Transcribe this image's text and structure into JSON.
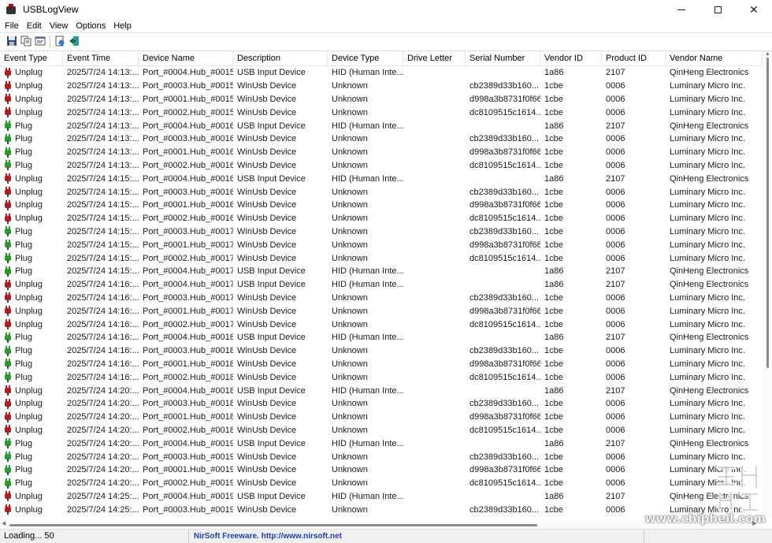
{
  "window": {
    "title": "USBLogView"
  },
  "menu": [
    "File",
    "Edit",
    "View",
    "Options",
    "Help"
  ],
  "toolbar": {
    "buttons": [
      {
        "name": "save-icon"
      },
      {
        "name": "copy-icon"
      },
      {
        "name": "properties-icon"
      },
      {
        "name": "html-report-icon"
      },
      {
        "name": "exit-icon"
      }
    ]
  },
  "columns": [
    "Event Type",
    "Event Time",
    "Device Name",
    "Description",
    "Device Type",
    "Drive Letter",
    "Serial Number",
    "Vendor ID",
    "Product ID",
    "Vendor Name"
  ],
  "rows": [
    [
      "Unplug",
      "2025/7/24 14:13:...",
      "Port_#0004.Hub_#0015",
      "USB Input Device",
      "HID (Human Inte...",
      "",
      "",
      "1a86",
      "2107",
      "QinHeng Electronics"
    ],
    [
      "Unplug",
      "2025/7/24 14:13:...",
      "Port_#0003.Hub_#0015",
      "WinUsb Device",
      "Unknown",
      "",
      "cb2389d33b160...",
      "1cbe",
      "0006",
      "Luminary Micro Inc."
    ],
    [
      "Unplug",
      "2025/7/24 14:13:...",
      "Port_#0001.Hub_#0015",
      "WinUsb Device",
      "Unknown",
      "",
      "d998a3b8731f0f66",
      "1cbe",
      "0006",
      "Luminary Micro Inc."
    ],
    [
      "Unplug",
      "2025/7/24 14:13:...",
      "Port_#0002.Hub_#0015",
      "WinUsb Device",
      "Unknown",
      "",
      "dc8109515c1614...",
      "1cbe",
      "0006",
      "Luminary Micro Inc."
    ],
    [
      "Plug",
      "2025/7/24 14:13:...",
      "Port_#0004.Hub_#0016",
      "USB Input Device",
      "HID (Human Inte...",
      "",
      "",
      "1a86",
      "2107",
      "QinHeng Electronics"
    ],
    [
      "Plug",
      "2025/7/24 14:13:...",
      "Port_#0003.Hub_#0016",
      "WinUsb Device",
      "Unknown",
      "",
      "cb2389d33b160...",
      "1cbe",
      "0006",
      "Luminary Micro Inc."
    ],
    [
      "Plug",
      "2025/7/24 14:13:...",
      "Port_#0001.Hub_#0016",
      "WinUsb Device",
      "Unknown",
      "",
      "d998a3b8731f0f66",
      "1cbe",
      "0006",
      "Luminary Micro Inc."
    ],
    [
      "Plug",
      "2025/7/24 14:13:...",
      "Port_#0002.Hub_#0016",
      "WinUsb Device",
      "Unknown",
      "",
      "dc8109515c1614...",
      "1cbe",
      "0006",
      "Luminary Micro Inc."
    ],
    [
      "Unplug",
      "2025/7/24 14:15:...",
      "Port_#0004.Hub_#0016",
      "USB Input Device",
      "HID (Human Inte...",
      "",
      "",
      "1a86",
      "2107",
      "QinHeng Electronics"
    ],
    [
      "Unplug",
      "2025/7/24 14:15:...",
      "Port_#0003.Hub_#0016",
      "WinUsb Device",
      "Unknown",
      "",
      "cb2389d33b160...",
      "1cbe",
      "0006",
      "Luminary Micro Inc."
    ],
    [
      "Unplug",
      "2025/7/24 14:15:...",
      "Port_#0001.Hub_#0016",
      "WinUsb Device",
      "Unknown",
      "",
      "d998a3b8731f0f66",
      "1cbe",
      "0006",
      "Luminary Micro Inc."
    ],
    [
      "Unplug",
      "2025/7/24 14:15:...",
      "Port_#0002.Hub_#0016",
      "WinUsb Device",
      "Unknown",
      "",
      "dc8109515c1614...",
      "1cbe",
      "0006",
      "Luminary Micro Inc."
    ],
    [
      "Plug",
      "2025/7/24 14:15:...",
      "Port_#0003.Hub_#0017",
      "WinUsb Device",
      "Unknown",
      "",
      "cb2389d33b160...",
      "1cbe",
      "0006",
      "Luminary Micro Inc."
    ],
    [
      "Plug",
      "2025/7/24 14:15:...",
      "Port_#0001.Hub_#0017",
      "WinUsb Device",
      "Unknown",
      "",
      "d998a3b8731f0f66",
      "1cbe",
      "0006",
      "Luminary Micro Inc."
    ],
    [
      "Plug",
      "2025/7/24 14:15:...",
      "Port_#0002.Hub_#0017",
      "WinUsb Device",
      "Unknown",
      "",
      "dc8109515c1614...",
      "1cbe",
      "0006",
      "Luminary Micro Inc."
    ],
    [
      "Plug",
      "2025/7/24 14:15:...",
      "Port_#0004.Hub_#0017",
      "USB Input Device",
      "HID (Human Inte...",
      "",
      "",
      "1a86",
      "2107",
      "QinHeng Electronics"
    ],
    [
      "Unplug",
      "2025/7/24 14:16:...",
      "Port_#0004.Hub_#0017",
      "USB Input Device",
      "HID (Human Inte...",
      "",
      "",
      "1a86",
      "2107",
      "QinHeng Electronics"
    ],
    [
      "Unplug",
      "2025/7/24 14:16:...",
      "Port_#0003.Hub_#0017",
      "WinUsb Device",
      "Unknown",
      "",
      "cb2389d33b160...",
      "1cbe",
      "0006",
      "Luminary Micro Inc."
    ],
    [
      "Unplug",
      "2025/7/24 14:16:...",
      "Port_#0001.Hub_#0017",
      "WinUsb Device",
      "Unknown",
      "",
      "d998a3b8731f0f66",
      "1cbe",
      "0006",
      "Luminary Micro Inc."
    ],
    [
      "Unplug",
      "2025/7/24 14:16:...",
      "Port_#0002.Hub_#0017",
      "WinUsb Device",
      "Unknown",
      "",
      "dc8109515c1614...",
      "1cbe",
      "0006",
      "Luminary Micro Inc."
    ],
    [
      "Plug",
      "2025/7/24 14:16:...",
      "Port_#0004.Hub_#0018",
      "USB Input Device",
      "HID (Human Inte...",
      "",
      "",
      "1a86",
      "2107",
      "QinHeng Electronics"
    ],
    [
      "Plug",
      "2025/7/24 14:16:...",
      "Port_#0003.Hub_#0018",
      "WinUsb Device",
      "Unknown",
      "",
      "cb2389d33b160...",
      "1cbe",
      "0006",
      "Luminary Micro Inc."
    ],
    [
      "Plug",
      "2025/7/24 14:16:...",
      "Port_#0001.Hub_#0018",
      "WinUsb Device",
      "Unknown",
      "",
      "d998a3b8731f0f66",
      "1cbe",
      "0006",
      "Luminary Micro Inc."
    ],
    [
      "Plug",
      "2025/7/24 14:16:...",
      "Port_#0002.Hub_#0018",
      "WinUsb Device",
      "Unknown",
      "",
      "dc8109515c1614...",
      "1cbe",
      "0006",
      "Luminary Micro Inc."
    ],
    [
      "Unplug",
      "2025/7/24 14:20:...",
      "Port_#0004.Hub_#0018",
      "USB Input Device",
      "HID (Human Inte...",
      "",
      "",
      "1a86",
      "2107",
      "QinHeng Electronics"
    ],
    [
      "Unplug",
      "2025/7/24 14:20:...",
      "Port_#0003.Hub_#0018",
      "WinUsb Device",
      "Unknown",
      "",
      "cb2389d33b160...",
      "1cbe",
      "0006",
      "Luminary Micro Inc."
    ],
    [
      "Unplug",
      "2025/7/24 14:20:...",
      "Port_#0001.Hub_#0018",
      "WinUsb Device",
      "Unknown",
      "",
      "d998a3b8731f0f66",
      "1cbe",
      "0006",
      "Luminary Micro Inc."
    ],
    [
      "Unplug",
      "2025/7/24 14:20:...",
      "Port_#0002.Hub_#0018",
      "WinUsb Device",
      "Unknown",
      "",
      "dc8109515c1614...",
      "1cbe",
      "0006",
      "Luminary Micro Inc."
    ],
    [
      "Plug",
      "2025/7/24 14:20:...",
      "Port_#0004.Hub_#0019",
      "USB Input Device",
      "HID (Human Inte...",
      "",
      "",
      "1a86",
      "2107",
      "QinHeng Electronics"
    ],
    [
      "Plug",
      "2025/7/24 14:20:...",
      "Port_#0003.Hub_#0019",
      "WinUsb Device",
      "Unknown",
      "",
      "cb2389d33b160...",
      "1cbe",
      "0006",
      "Luminary Micro Inc."
    ],
    [
      "Plug",
      "2025/7/24 14:20:...",
      "Port_#0001.Hub_#0019",
      "WinUsb Device",
      "Unknown",
      "",
      "d998a3b8731f0f66",
      "1cbe",
      "0006",
      "Luminary Micro Inc."
    ],
    [
      "Plug",
      "2025/7/24 14:20:...",
      "Port_#0002.Hub_#0019",
      "WinUsb Device",
      "Unknown",
      "",
      "dc8109515c1614...",
      "1cbe",
      "0006",
      "Luminary Micro Inc."
    ],
    [
      "Unplug",
      "2025/7/24 14:25:...",
      "Port_#0004.Hub_#0019",
      "USB Input Device",
      "HID (Human Inte...",
      "",
      "",
      "1a86",
      "2107",
      "QinHeng Electronics"
    ],
    [
      "Unplug",
      "2025/7/24 14:25:...",
      "Port_#0003.Hub_#0019",
      "WinUsb Device",
      "Unknown",
      "",
      "cb2389d33b160...",
      "1cbe",
      "0006",
      "Luminary Micro Inc."
    ]
  ],
  "status": {
    "left": "Loading... 50",
    "middle": "NirSoft Freeware.  http://www.nirsoft.net"
  },
  "watermark": {
    "text": "www.chiphell.com"
  },
  "colors": {
    "plug": "#2e9a2e",
    "unplug": "#b01f1f",
    "link": "#1c3fa8"
  }
}
